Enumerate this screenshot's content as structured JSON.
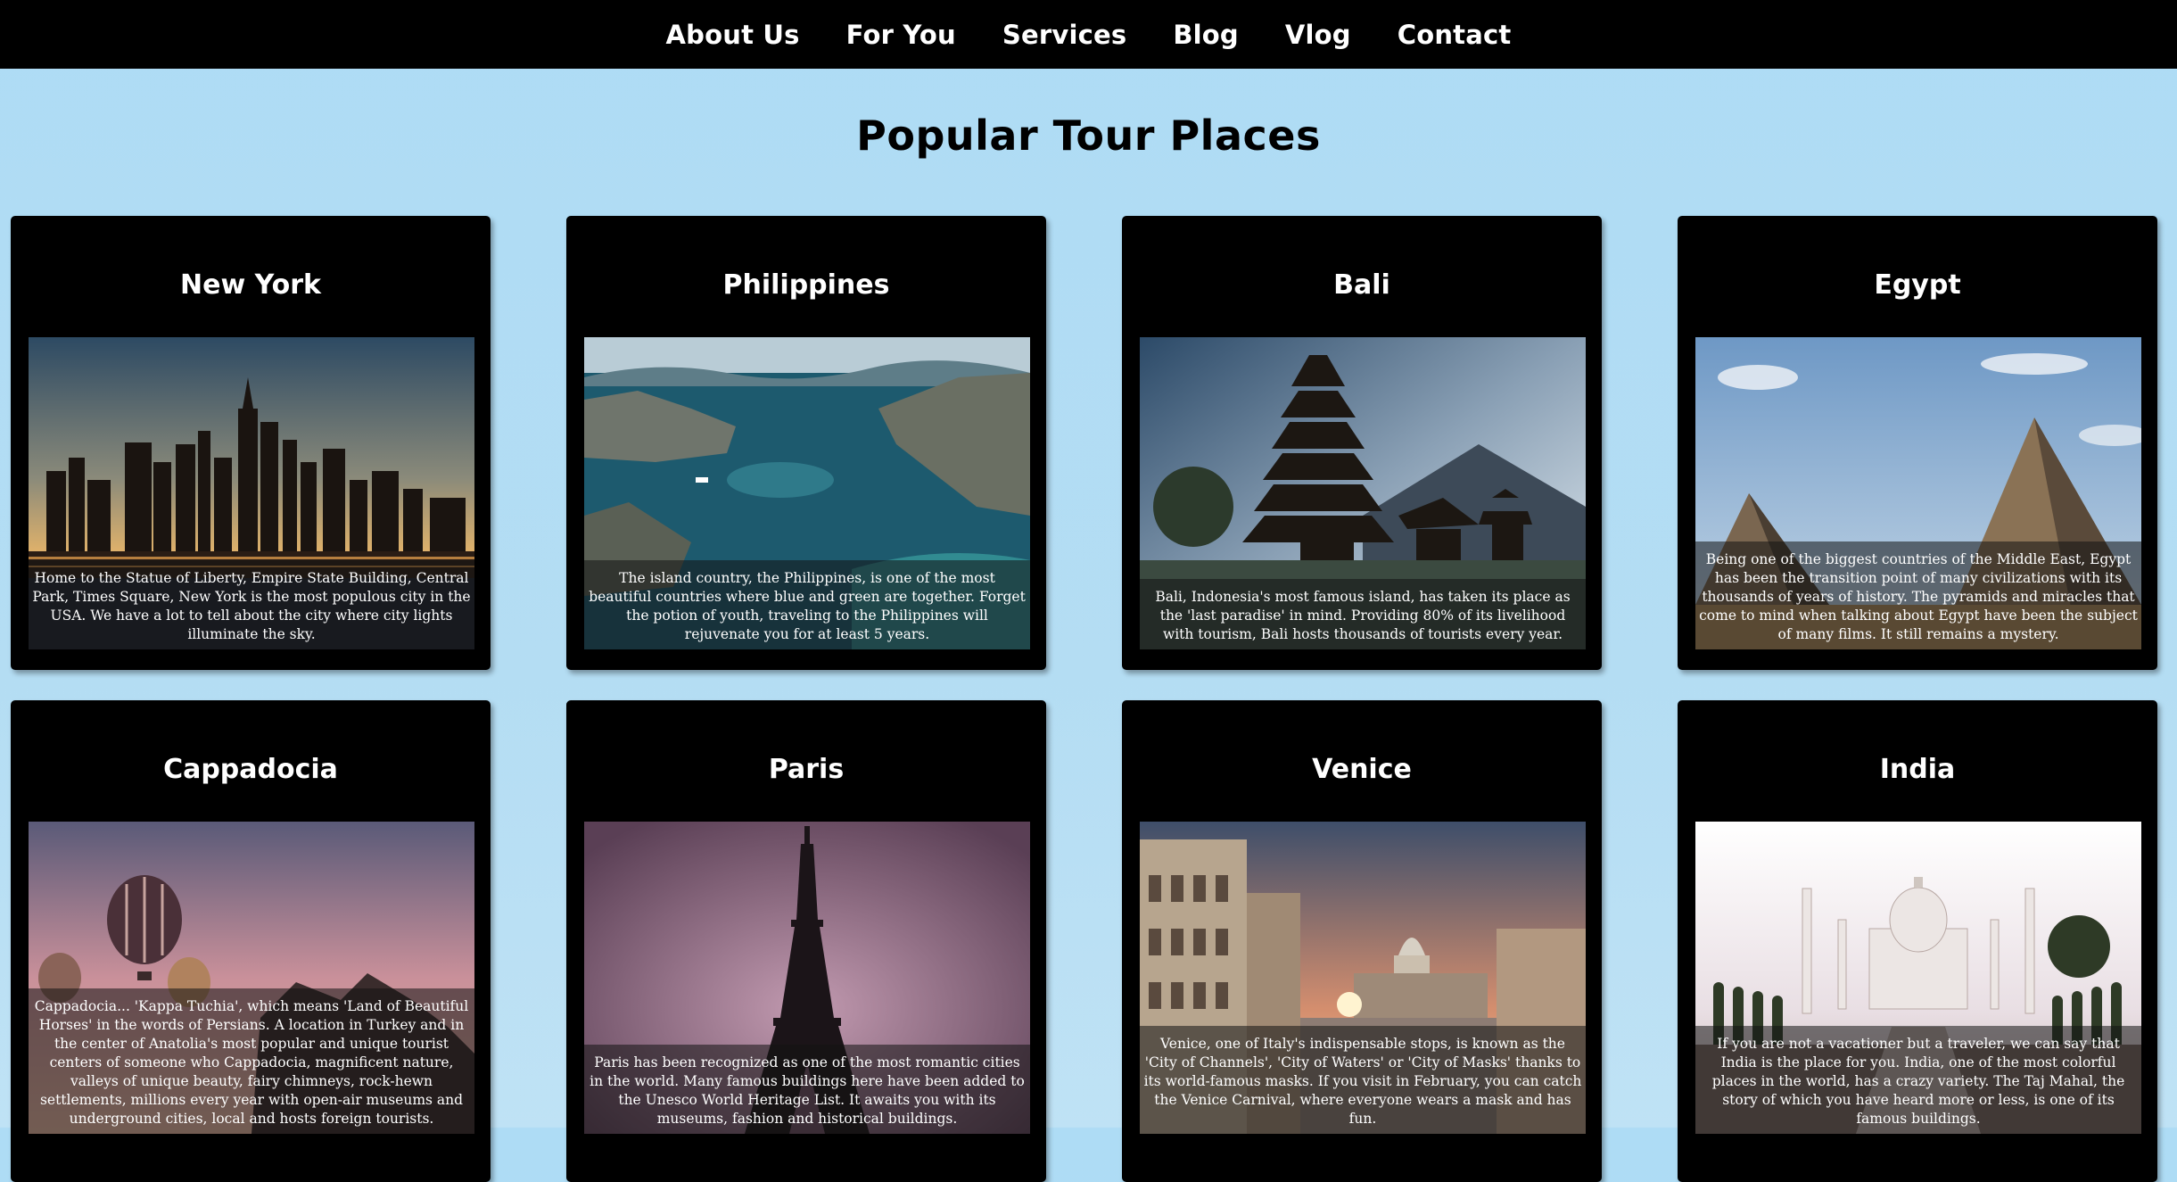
{
  "nav": {
    "items": [
      "About Us",
      "For You",
      "Services",
      "Blog",
      "Vlog",
      "Contact"
    ]
  },
  "page": {
    "title": "Popular Tour Places"
  },
  "places": [
    {
      "title": "New York",
      "description": "Home to the Statue of Liberty, Empire State Building, Central Park, Times Square, New York is the most populous city in the USA. We have a lot to tell about the city where city lights illuminate the sky."
    },
    {
      "title": "Philippines",
      "description": "The island country, the Philippines, is one of the most beautiful countries where blue and green are together. Forget the potion of youth, traveling to the Philippines will rejuvenate you for at least 5 years."
    },
    {
      "title": "Bali",
      "description": "Bali, Indonesia's most famous island, has taken its place as the 'last paradise' in mind. Providing 80% of its livelihood with tourism, Bali hosts thousands of tourists every year."
    },
    {
      "title": "Egypt",
      "description": "Being one of the biggest countries of the Middle East, Egypt has been the transition point of many civilizations with its thousands of years of history. The pyramids and miracles that come to mind when talking about Egypt have been the subject of many films. It still remains a mystery."
    },
    {
      "title": "Cappadocia",
      "description": "Cappadocia... 'Kappa Tuchia', which means 'Land of Beautiful Horses' in the words of Persians. A location in Turkey and in the center of Anatolia's most popular and unique tourist centers of someone who Cappadocia, magnificent nature, valleys of unique beauty, fairy chimneys, rock-hewn settlements, millions every year with open-air museums and underground cities, local and hosts foreign tourists."
    },
    {
      "title": "Paris",
      "description": "Paris has been recognized as one of the most romantic cities in the world. Many famous buildings here have been added to the Unesco World Heritage List. It awaits you with its museums, fashion and historical buildings."
    },
    {
      "title": "Venice",
      "description": "Venice, one of Italy's indispensable stops, is known as the 'City of Channels', 'City of Waters' or 'City of Masks' thanks to its world-famous masks. If you visit in February, you can catch the Venice Carnival, where everyone wears a mask and has fun."
    },
    {
      "title": "India",
      "description": "If you are not a vacationer but a traveler, we can say that India is the place for you. India, one of the most colorful places in the world, has a crazy variety. The Taj Mahal, the story of which you have heard more or less, is one of its famous buildings."
    }
  ]
}
